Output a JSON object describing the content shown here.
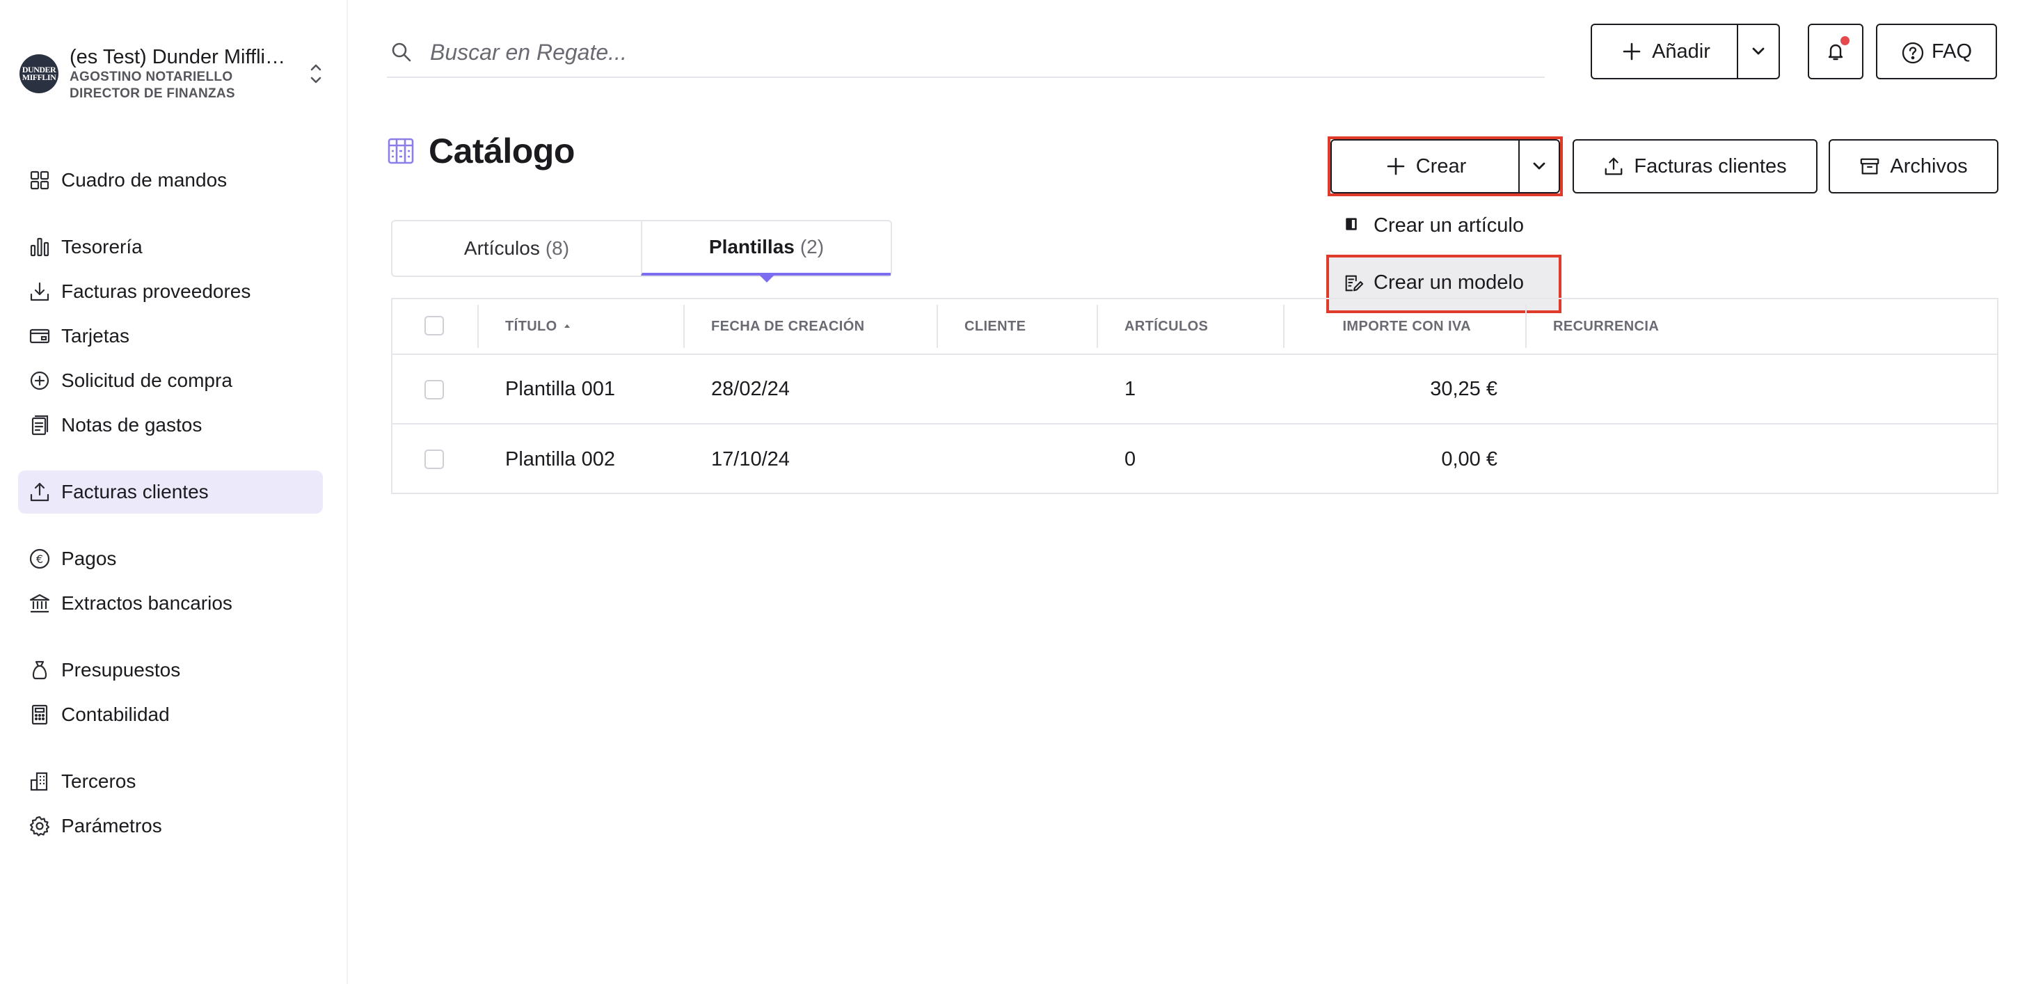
{
  "org": {
    "logo_line1": "DUNDER",
    "logo_line2": "MIFFLIN",
    "name": "(es Test) Dunder Mifflin...",
    "user": "AGOSTINO NOTARIELLO",
    "role": "DIRECTOR DE FINANZAS"
  },
  "sidebar": {
    "items": [
      {
        "label": "Cuadro de mandos",
        "icon": "dashboard-icon"
      },
      {
        "label": "Tesorería",
        "icon": "bar-chart-icon"
      },
      {
        "label": "Facturas proveedores",
        "icon": "download-icon"
      },
      {
        "label": "Tarjetas",
        "icon": "card-icon"
      },
      {
        "label": "Solicitud de compra",
        "icon": "plus-circle-icon"
      },
      {
        "label": "Notas de gastos",
        "icon": "receipt-icon"
      },
      {
        "label": "Facturas clientes",
        "icon": "upload-icon"
      },
      {
        "label": "Pagos",
        "icon": "euro-icon"
      },
      {
        "label": "Extractos bancarios",
        "icon": "bank-icon"
      },
      {
        "label": "Presupuestos",
        "icon": "money-bag-icon"
      },
      {
        "label": "Contabilidad",
        "icon": "calculator-icon"
      },
      {
        "label": "Terceros",
        "icon": "building-icon"
      },
      {
        "label": "Parámetros",
        "icon": "gear-icon"
      }
    ],
    "active_index": 6
  },
  "search": {
    "placeholder": "Buscar en Regate..."
  },
  "topbar": {
    "add_label": "Añadir",
    "faq_label": "FAQ"
  },
  "page": {
    "title": "Catálogo",
    "create_label": "Crear",
    "customer_invoices_label": "Facturas clientes",
    "archives_label": "Archivos"
  },
  "dropdown": {
    "items": [
      {
        "label": "Crear un artículo",
        "icon": "book-icon"
      },
      {
        "label": "Crear un modelo",
        "icon": "template-edit-icon"
      }
    ]
  },
  "tabs": [
    {
      "label": "Artículos",
      "count": "(8)"
    },
    {
      "label": "Plantillas",
      "count": "(2)"
    }
  ],
  "table": {
    "columns": [
      "TÍTULO",
      "FECHA DE CREACIÓN",
      "CLIENTE",
      "ARTÍCULOS",
      "IMPORTE CON IVA",
      "RECURRENCIA"
    ],
    "rows": [
      {
        "title": "Plantilla 001",
        "date": "28/02/24",
        "client": "",
        "items": "1",
        "amount": "30,25 €",
        "recurrence": ""
      },
      {
        "title": "Plantilla 002",
        "date": "17/10/24",
        "client": "",
        "items": "0",
        "amount": "0,00 €",
        "recurrence": ""
      }
    ]
  },
  "colors": {
    "accent": "#7c6cf0",
    "active_nav_bg": "#ece9fb",
    "highlight_border": "#e03b2a",
    "notification_dot": "#e5484d"
  }
}
